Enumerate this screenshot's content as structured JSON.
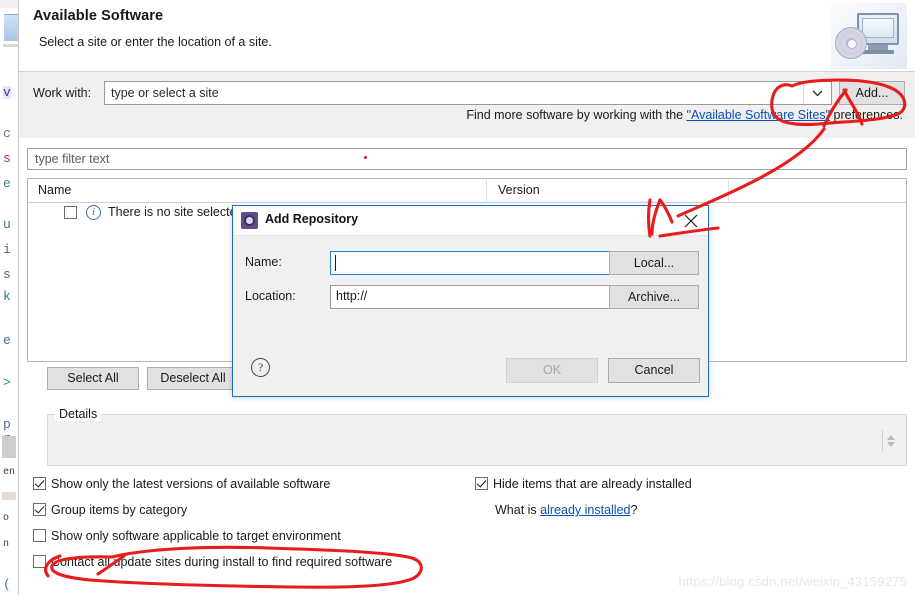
{
  "window": {
    "title": "Available Software",
    "subtitle": "Select a site or enter the location of a site.",
    "header_icon": "monitor-cd-icon"
  },
  "work_with": {
    "label": "Work with:",
    "value": "",
    "placeholder": "type or select a site",
    "dropdown_icon": "chevron-down-icon",
    "add_button": "Add..."
  },
  "find_more": {
    "prefix": "Find more software by working with the ",
    "link": "\"Available Software Sites\"",
    "suffix": " preferences."
  },
  "filter": {
    "placeholder": "type filter text",
    "value": ""
  },
  "table": {
    "columns": [
      "Name",
      "Version"
    ],
    "rows": [
      {
        "checked": false,
        "icon": "info-icon",
        "name": "There is no site selected",
        "version": ""
      }
    ]
  },
  "table_buttons": {
    "select_all": "Select All",
    "deselect_all": "Deselect All"
  },
  "details": {
    "legend": "Details",
    "body": "",
    "spinner_icon": "spinner-updown-icon"
  },
  "options": {
    "left": [
      {
        "label": "Show only the latest versions of available software",
        "checked": true
      },
      {
        "label": "Group items by category",
        "checked": true
      },
      {
        "label": "Show only software applicable to target environment",
        "checked": false
      },
      {
        "label": "Contact all update sites during install to find required software",
        "checked": false
      }
    ],
    "right": [
      {
        "label": "Hide items that are already installed",
        "checked": true
      }
    ],
    "what_is": {
      "prefix": "What is ",
      "link": "already installed",
      "suffix": "?"
    }
  },
  "modal": {
    "title": "Add Repository",
    "icon": "repository-gear-icon",
    "close_icon": "close-icon",
    "name_label": "Name:",
    "name_value": "",
    "location_label": "Location:",
    "location_value": "http://",
    "local_button": "Local...",
    "archive_button": "Archive...",
    "help_icon": "help-question-icon",
    "ok_button": "OK",
    "ok_enabled": false,
    "cancel_button": "Cancel"
  },
  "annotations": {
    "ink_color": "#e81c1c",
    "marks": [
      "circle-around-dropdown-and-add-button",
      "arrow-from-add-button-to-dialog-close",
      "oval-around-contact-all-update-sites-option"
    ]
  },
  "watermark": "https://blog.csdn.net/weixin_43159275",
  "background_editor": {
    "glyphs": [
      "v",
      "c",
      "s",
      "e",
      "u",
      "i",
      "s",
      "k",
      "e",
      ">",
      "p",
      "r",
      "en",
      "o",
      "n",
      "("
    ]
  }
}
